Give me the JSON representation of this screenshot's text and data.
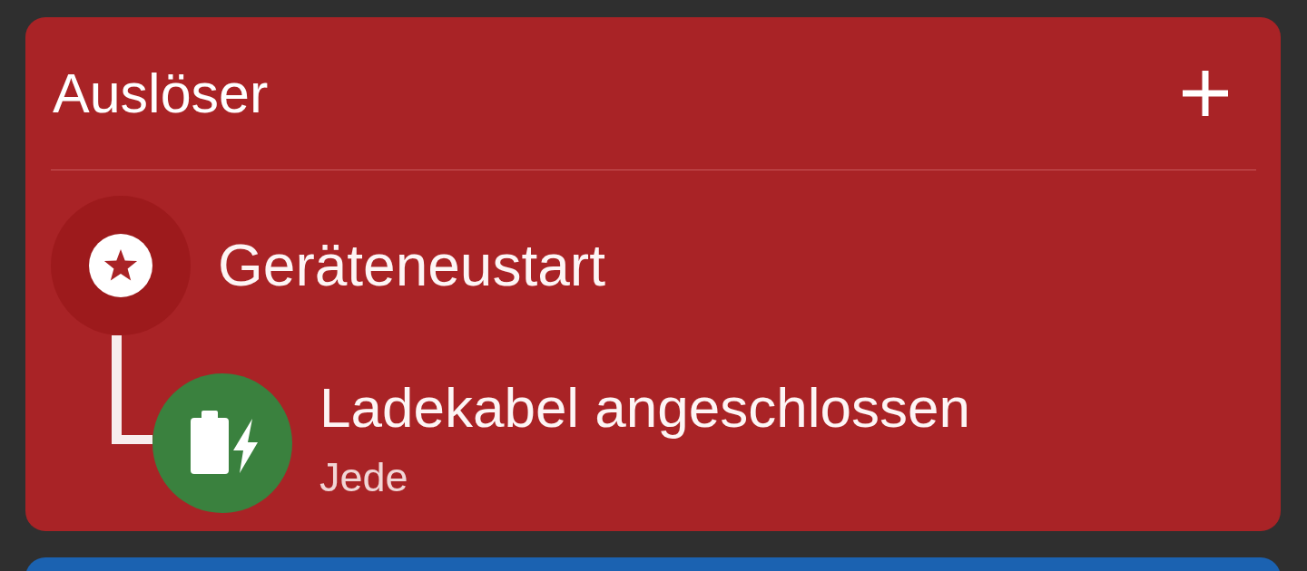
{
  "panels": [
    {
      "color": "#a92326",
      "title": "Auslöser",
      "triggers": [
        {
          "kind": "boot",
          "color": "#9d1a1c",
          "label": "Geräteneustart",
          "children": [
            {
              "kind": "charging",
              "color": "#3a813e",
              "label": "Ladekabel angeschlossen",
              "detail": "Jede"
            }
          ]
        }
      ]
    },
    {
      "color": "#1b62b1"
    }
  ]
}
